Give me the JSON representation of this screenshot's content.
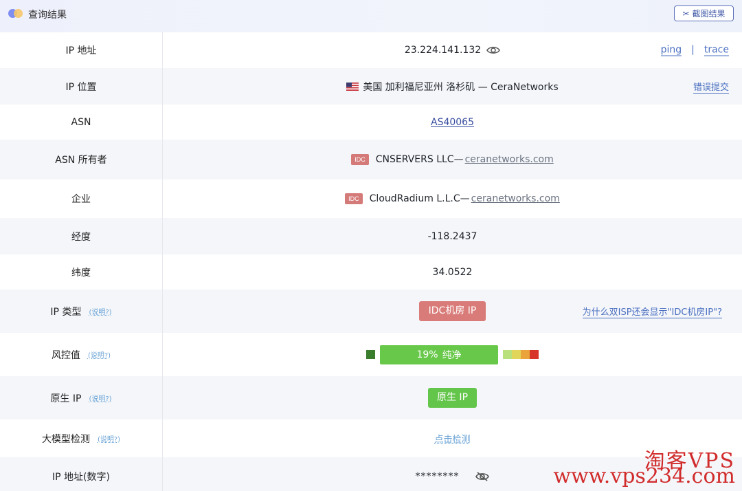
{
  "header": {
    "title": "查询结果",
    "screenshot_button": "截图结果"
  },
  "rows": {
    "ip": {
      "label": "IP 地址",
      "value": "23.224.141.132",
      "ping": "ping",
      "separator": "|",
      "trace": "trace"
    },
    "location": {
      "label": "IP 位置",
      "value": "美国 加利福尼亚州 洛杉矶 — CeraNetworks",
      "report": "错误提交"
    },
    "asn": {
      "label": "ASN",
      "value": "AS40065"
    },
    "asn_owner": {
      "label": "ASN 所有者",
      "badge": "IDC",
      "name": "CNSERVERS LLC—",
      "domain": "ceranetworks.com"
    },
    "company": {
      "label": "企业",
      "badge": "IDC",
      "name": "CloudRadium L.L.C—",
      "domain": "ceranetworks.com"
    },
    "longitude": {
      "label": "经度",
      "value": "-118.2437"
    },
    "latitude": {
      "label": "纬度",
      "value": "34.0522"
    },
    "ip_type": {
      "label": "IP 类型",
      "explain": "(说明?)",
      "value": "IDC机房 IP",
      "why": "为什么双ISP还会显示\"IDC机房IP\"?"
    },
    "risk": {
      "label": "风控值",
      "explain": "(说明?)",
      "percent": "19%",
      "level": "纯净",
      "value": 0.19
    },
    "native": {
      "label": "原生 IP",
      "explain": "(说明?)",
      "value": "原生 IP"
    },
    "llm": {
      "label": "大模型检测",
      "explain": "(说明?)",
      "value": "点击检测"
    },
    "ip_number": {
      "label": "IP 地址(数字)",
      "value": "********"
    }
  },
  "colors": {
    "idc_red": "#d97b78",
    "green": "#63c54a",
    "dark_green": "#3a7d2c",
    "link_blue": "#4a6fc0"
  },
  "watermark": {
    "line1": "淘客VPS",
    "line2": "www.vps234.com"
  }
}
